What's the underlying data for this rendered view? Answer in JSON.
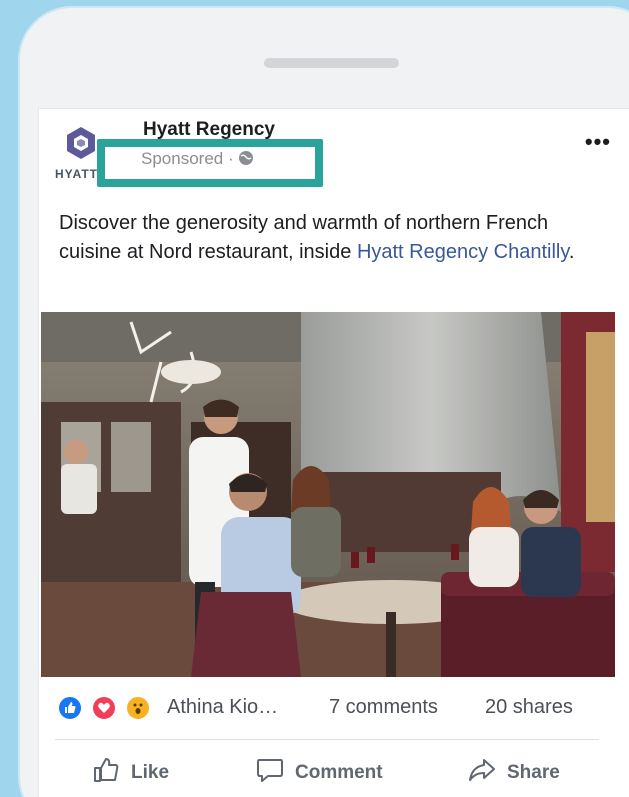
{
  "post": {
    "page_name": "Hyatt Regency",
    "sponsored_label": "Sponsored ·",
    "more_label": "•••",
    "logo_text": "HYATT",
    "text_main": "Discover the generosity and warmth of northern French cuisine at Nord restaurant, inside ",
    "text_link": "Hyatt Regency Chantilly",
    "text_end": ".",
    "image_alt": "Diners at Nord restaurant"
  },
  "reactions": {
    "icons": [
      "like-icon",
      "love-icon",
      "wow-icon"
    ],
    "reactor_name": "Athina Kio…",
    "comments": "7 comments",
    "shares": "20 shares"
  },
  "actions": {
    "like": "Like",
    "comment": "Comment",
    "share": "Share"
  },
  "colors": {
    "background": "#9fd6ee",
    "highlight": "#2aa39b",
    "link": "#385898"
  }
}
